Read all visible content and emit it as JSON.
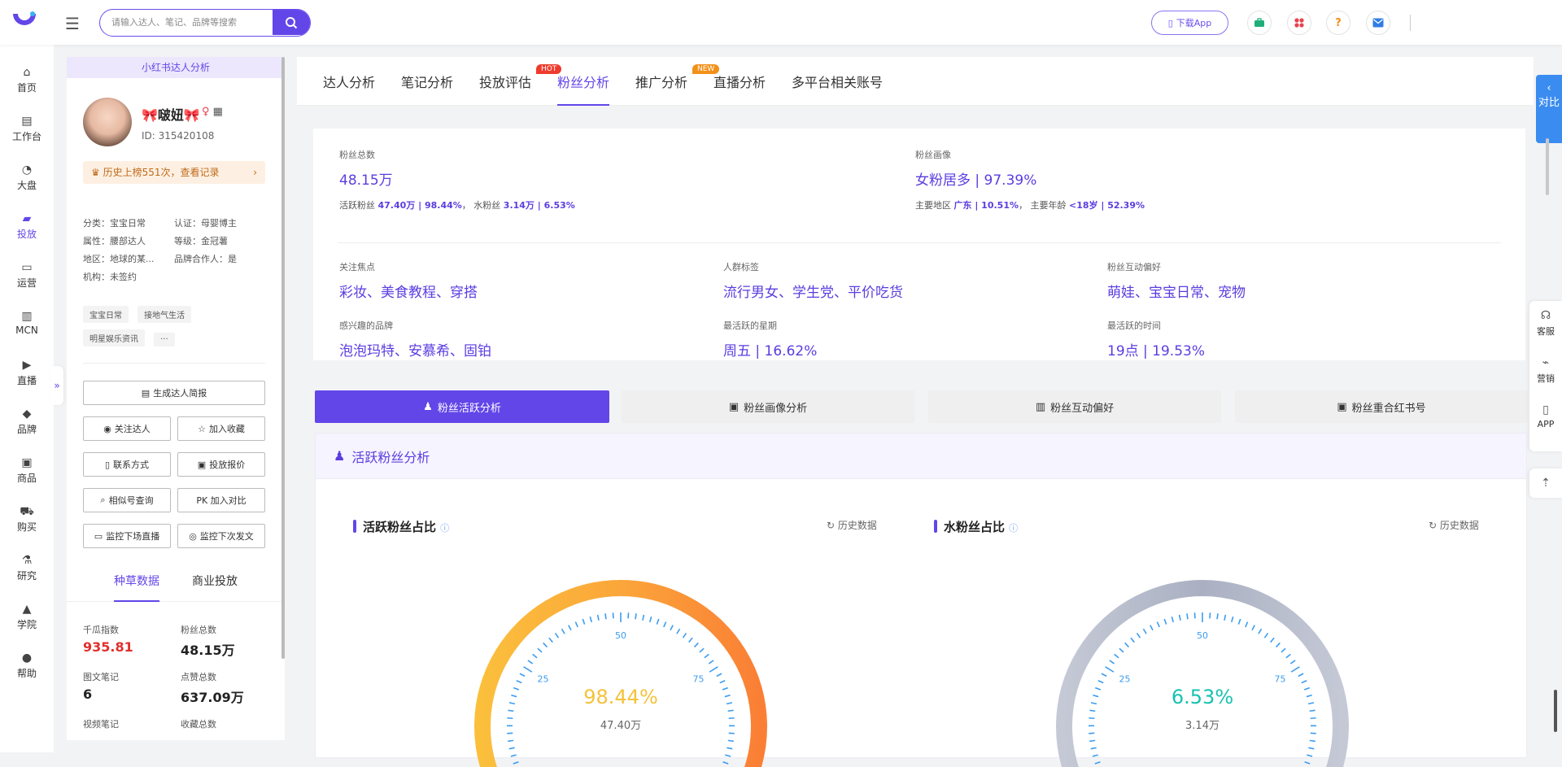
{
  "topbar": {
    "search_placeholder": "请输入达人、笔记、品牌等搜索",
    "download_app": "下载App",
    "icons": [
      "briefcase-icon",
      "apps-icon",
      "help-icon",
      "mail-icon"
    ],
    "help_symbol": "?"
  },
  "nav": [
    {
      "label": "首页",
      "icon": "home-icon"
    },
    {
      "label": "工作台",
      "icon": "workbench-icon"
    },
    {
      "label": "大盘",
      "icon": "pie-icon"
    },
    {
      "label": "投放",
      "icon": "folder-icon",
      "active": true
    },
    {
      "label": "运营",
      "icon": "chat-icon"
    },
    {
      "label": "MCN",
      "icon": "building-icon"
    },
    {
      "label": "直播",
      "icon": "video-icon"
    },
    {
      "label": "品牌",
      "icon": "brand-icon"
    },
    {
      "label": "商品",
      "icon": "bag-icon"
    },
    {
      "label": "购买",
      "icon": "cart-icon"
    },
    {
      "label": "研究",
      "icon": "flask-icon"
    },
    {
      "label": "学院",
      "icon": "graduation-icon"
    },
    {
      "label": "帮助",
      "icon": "help-icon"
    }
  ],
  "profile": {
    "header": "小红书达人分析",
    "nickname": "🎀啵妞🎀",
    "uid": "ID: 315420108",
    "rank_text": "历史上榜551次，查看记录",
    "info": {
      "category": "分类：宝宝日常",
      "certification": "认证：母婴博主",
      "attribute": "属性：腰部达人",
      "level": "等级：金冠薯",
      "region": "地区：地球的某...",
      "brand_partner": "品牌合作人：是",
      "agency": "机构：未签约"
    },
    "tags": [
      "宝宝日常",
      "接地气生活",
      "明星娱乐资讯",
      "···"
    ],
    "buttons": {
      "report": "生成达人简报",
      "follow": "关注达人",
      "favorite": "加入收藏",
      "contact": "联系方式",
      "quote": "投放报价",
      "similar": "相似号查询",
      "compare": "PK 加入对比",
      "monitor_live": "监控下场直播",
      "monitor_post": "监控下次发文"
    },
    "tabs": [
      "种草数据",
      "商业投放"
    ],
    "stats": [
      {
        "label": "千瓜指数",
        "value": "935.81",
        "highlight": true
      },
      {
        "label": "粉丝总数",
        "value": "48.15万"
      },
      {
        "label": "图文笔记",
        "value": "6"
      },
      {
        "label": "点赞总数",
        "value": "637.09万"
      },
      {
        "label": "视频笔记",
        "value": ""
      },
      {
        "label": "收藏总数",
        "value": ""
      }
    ]
  },
  "tabs": [
    {
      "label": "达人分析"
    },
    {
      "label": "笔记分析"
    },
    {
      "label": "投放评估",
      "badge": "HOT"
    },
    {
      "label": "粉丝分析",
      "active": true
    },
    {
      "label": "推广分析",
      "badge": "NEW"
    },
    {
      "label": "直播分析"
    },
    {
      "label": "多平台相关账号"
    }
  ],
  "overview": {
    "total_fans": {
      "label": "粉丝总数",
      "value": "48.15万",
      "sub_prefix": "活跃粉丝",
      "active": "47.40万 | 98.44%",
      "sub_mid": "，  水粉丝",
      "water": "3.14万 | 6.53%"
    },
    "portrait": {
      "label": "粉丝画像",
      "value": "女粉居多 | 97.39%",
      "sub_prefix": "主要地区",
      "region": "广东 | 10.51%",
      "sub_mid": "，  主要年龄",
      "age": "<18岁 | 52.39%"
    },
    "focus": {
      "label": "关注焦点",
      "value": "彩妆、美食教程、穿搭"
    },
    "crowd": {
      "label": "人群标签",
      "value": "流行男女、学生党、平价吃货"
    },
    "interaction": {
      "label": "粉丝互动偏好",
      "value": "萌娃、宝宝日常、宠物"
    },
    "brands": {
      "label": "感兴趣的品牌",
      "value": "泡泡玛特、安慕希、固铂"
    },
    "weekday": {
      "label": "最活跃的星期",
      "value": "周五 | 16.62%"
    },
    "hour": {
      "label": "最活跃的时间",
      "value": "19点 | 19.53%"
    }
  },
  "segments": [
    "粉丝活跃分析",
    "粉丝画像分析",
    "粉丝互动偏好",
    "粉丝重合红书号"
  ],
  "active_analysis": {
    "title": "活跃粉丝分析",
    "history": "历史数据",
    "gauge_left": {
      "title": "活跃粉丝占比",
      "percent_text": "98.44%",
      "sub": "47.40万",
      "percent": 98.44,
      "color": "#f5c23a"
    },
    "gauge_right": {
      "title": "水粉丝占比",
      "percent_text": "6.53%",
      "sub": "3.14万",
      "percent": 6.53,
      "color": "#18c2b0"
    },
    "ticks": [
      "25",
      "50",
      "75"
    ]
  },
  "right_rail": {
    "compare": "对比",
    "items": [
      "客服",
      "营销",
      "APP"
    ]
  }
}
